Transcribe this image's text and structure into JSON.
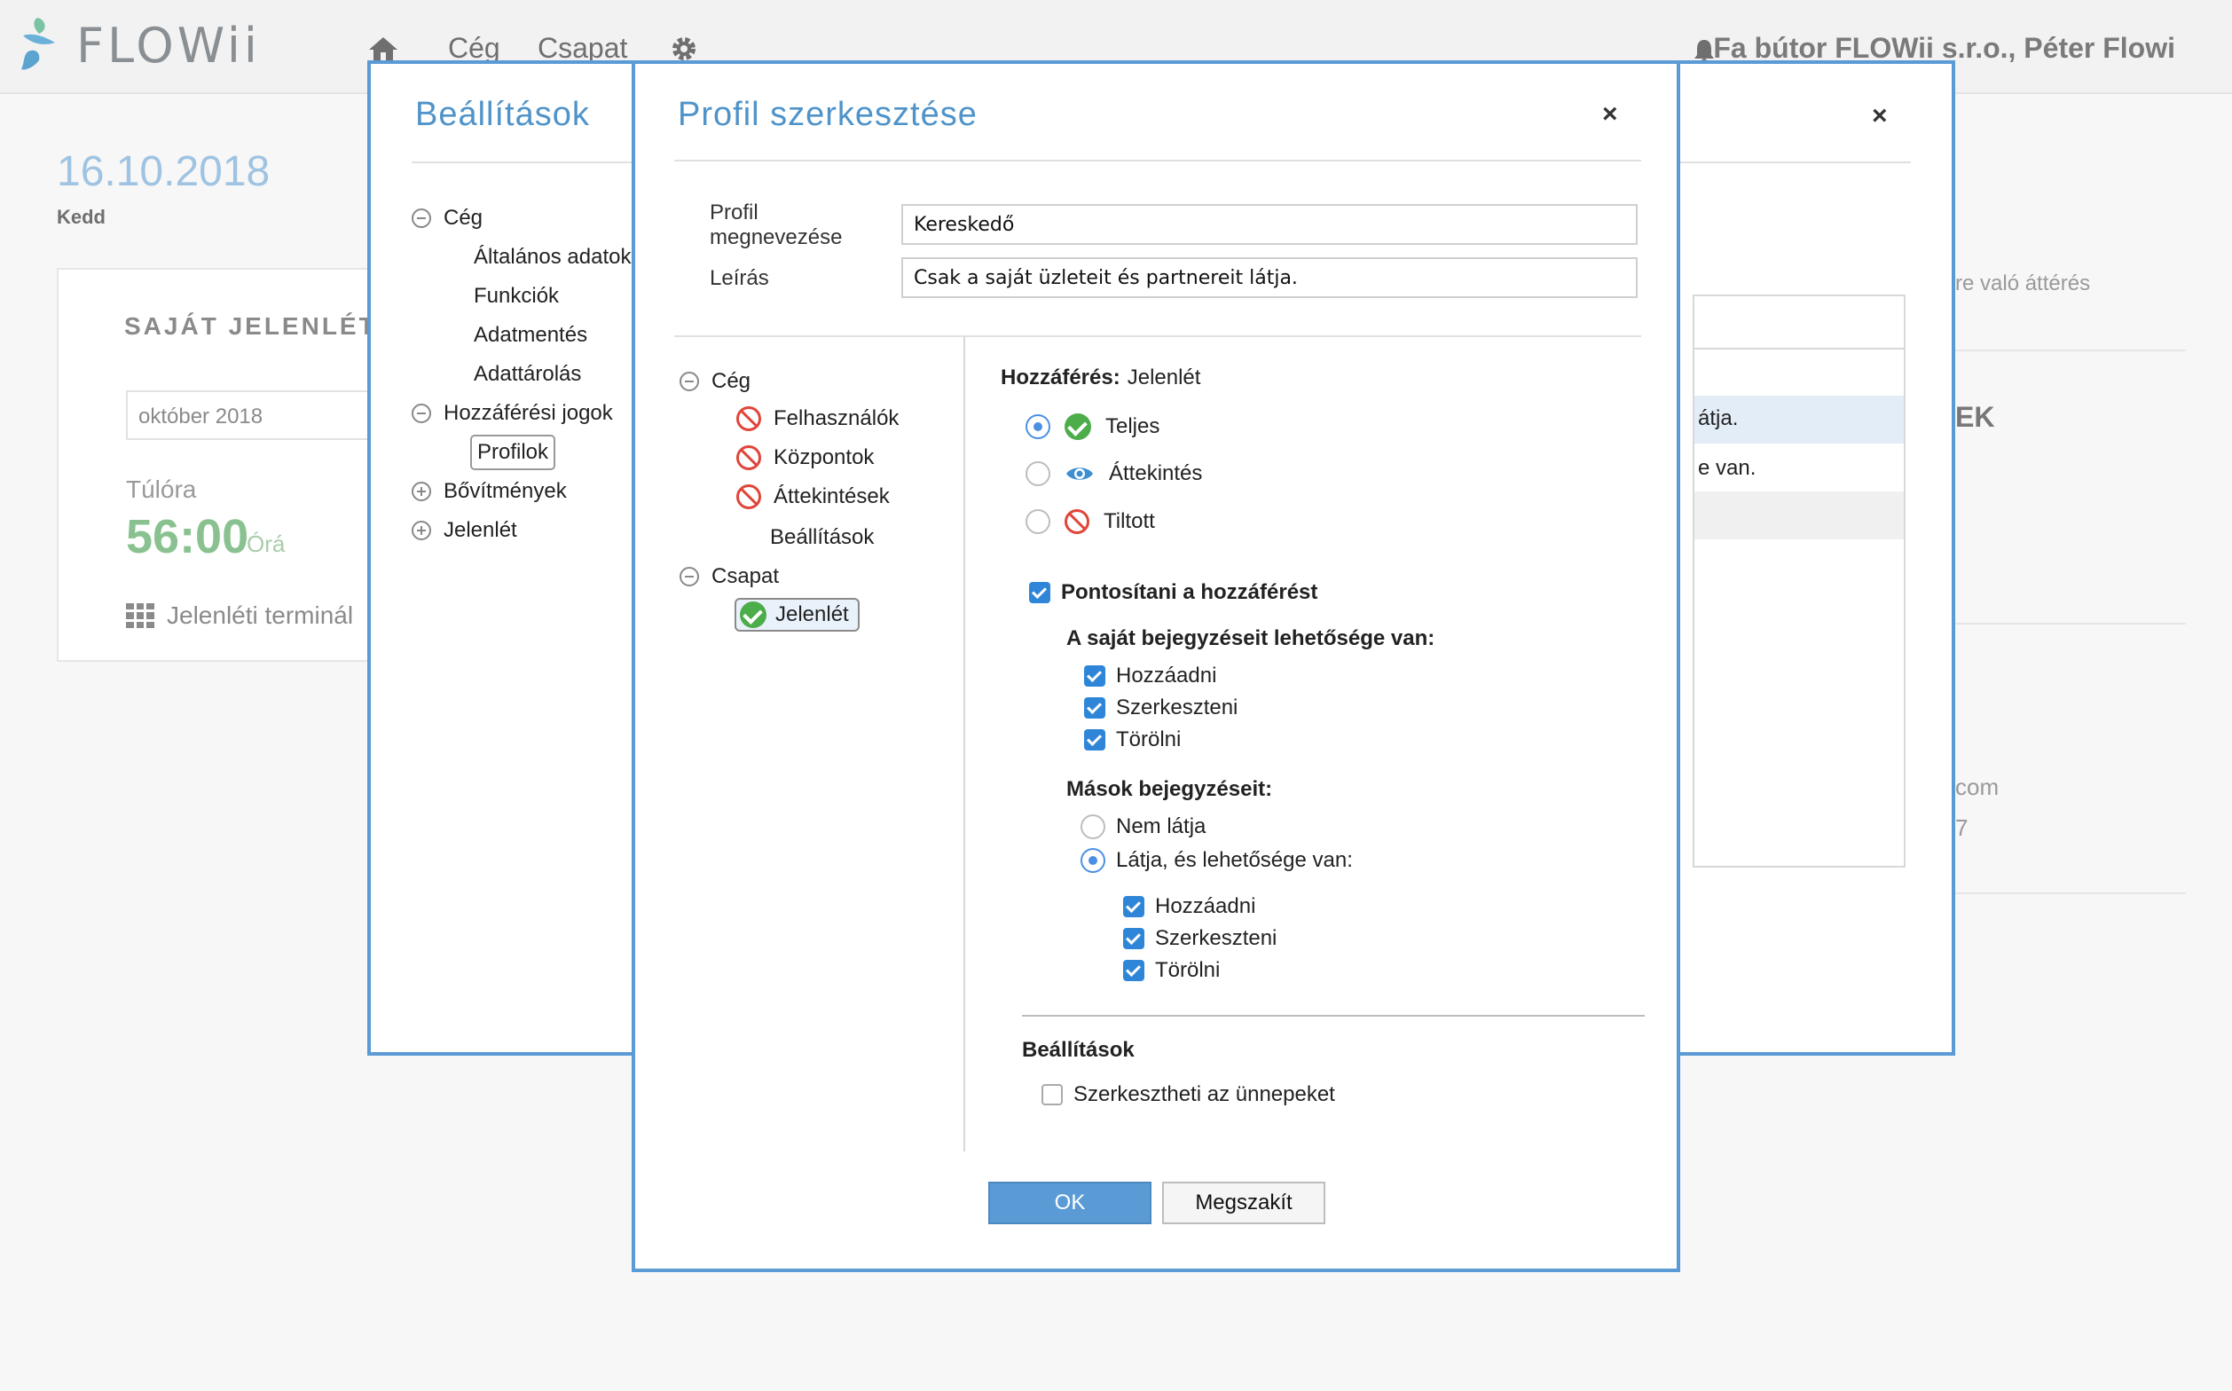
{
  "app": {
    "logo_text": "FLOWii"
  },
  "nav": {
    "items": [
      "Cég",
      "Csapat"
    ],
    "user": "Fa bútor FLOWii s.r.o., Péter Flowi"
  },
  "background": {
    "date": "16.10.2018",
    "day": "Kedd",
    "card_title": "SAJÁT JELENLÉT",
    "month": "október 2018",
    "overtime_label": "Túlóra",
    "overtime_value": "56:00",
    "overtime_unit": "Órá",
    "terminal": "Jelenléti terminál",
    "right_fragments": [
      "cre való áttérés",
      "EK",
      "com",
      "7"
    ]
  },
  "settings": {
    "title": "Beállítások",
    "close": "×",
    "tree": [
      "Cég",
      "Általános adatok",
      "Funkciók",
      "Adatmentés",
      "Adattárolás",
      "Hozzáférési jogok",
      "Profilok",
      "Bővítmények",
      "Jelenlét"
    ],
    "panel_fragments": [
      "átja.",
      "e van."
    ]
  },
  "profile": {
    "title": "Profil szerkesztése",
    "close": "×",
    "name_label": "Profil megnevezése",
    "name_value": "Kereskedő",
    "desc_label": "Leírás",
    "desc_value": "Csak a saját üzleteit és partnereit látja.",
    "tree": [
      "Cég",
      "Felhasználók",
      "Központok",
      "Áttekintések",
      "Beállítások",
      "Csapat",
      "Jelenlét"
    ],
    "access_label": "Hozzáférés:",
    "access_value": "Jelenlét",
    "access_options": [
      "Teljes",
      "Áttekintés",
      "Tiltott"
    ],
    "specify": "Pontosítani a hozzáférést",
    "own_heading": "A saját bejegyzéseit lehetősége van:",
    "own_items": [
      "Hozzáadni",
      "Szerkeszteni",
      "Törölni"
    ],
    "others_heading": "Mások bejegyzéseit:",
    "others_options": [
      "Nem látja",
      "Látja, és lehetősége van:"
    ],
    "others_items": [
      "Hozzáadni",
      "Szerkeszteni",
      "Törölni"
    ],
    "settings_heading": "Beállítások",
    "holidays": "Szerkesztheti az ünnepeket",
    "ok": "OK",
    "cancel": "Megszakít"
  }
}
